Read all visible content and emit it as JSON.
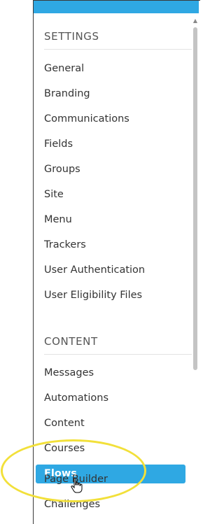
{
  "settings": {
    "title": "SETTINGS",
    "items": [
      "General",
      "Branding",
      "Communications",
      "Fields",
      "Groups",
      "Site",
      "Menu",
      "Trackers",
      "User Authentication",
      "User Eligibility Files"
    ]
  },
  "content": {
    "title": "CONTENT",
    "items": [
      "Messages",
      "Automations",
      "Content",
      "Courses"
    ],
    "active_item": "Flows",
    "after_items": [
      "Page Builder",
      "Challenges"
    ]
  },
  "colors": {
    "accent": "#2fa8e3",
    "highlight_ring": "#f2e03a"
  },
  "icons": {
    "pointer": "hand-pointer-icon",
    "scroll_up": "scroll-up-arrow-icon"
  }
}
